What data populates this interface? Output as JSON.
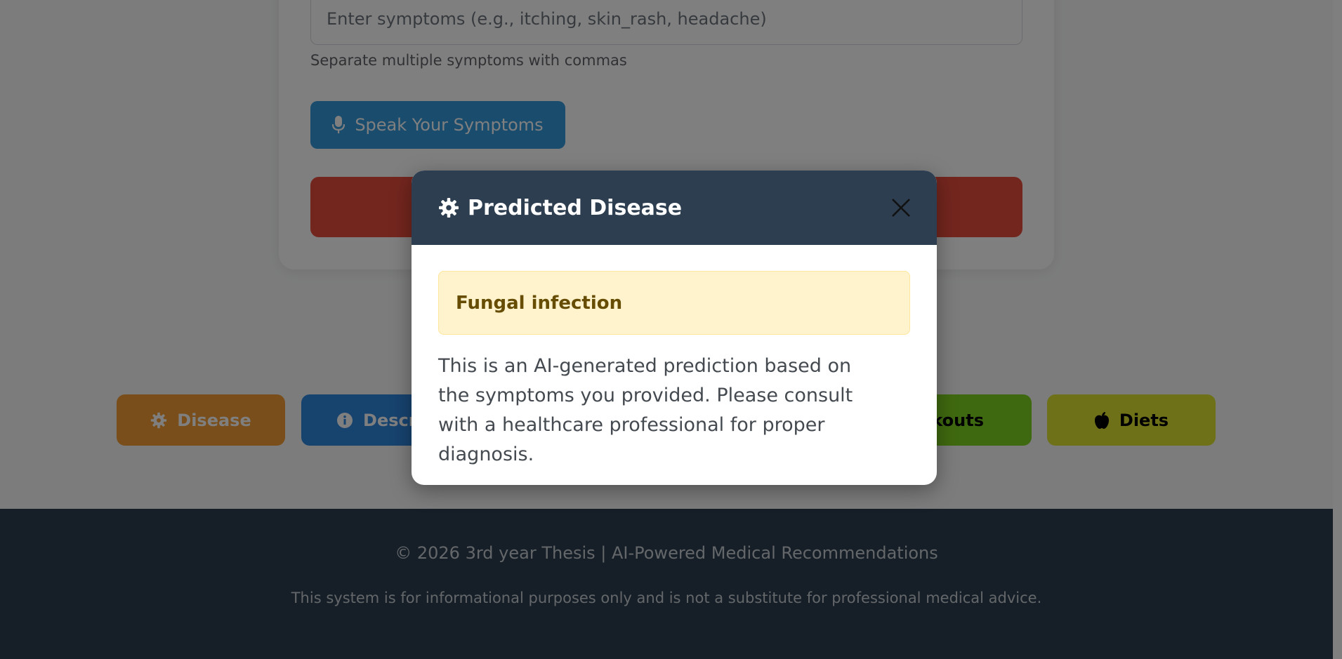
{
  "form": {
    "symptoms_placeholder": "Enter symptoms (e.g., itching, skin_rash, headache)",
    "helper_text": "Separate multiple symptoms with commas",
    "speak_label": "Speak Your Symptoms"
  },
  "tabs": [
    {
      "label": "Disease",
      "icon": "gear-icon",
      "color": "#f39c35"
    },
    {
      "label": "Descrip",
      "icon": "info-icon",
      "color": "#2e86de"
    },
    {
      "label": "orkouts",
      "color": "#7ed321"
    },
    {
      "label": "Diets",
      "icon": "apple-icon",
      "color": "#dde331"
    }
  ],
  "modal": {
    "title": "Predicted Disease",
    "prediction": "Fungal infection",
    "body": "This is an AI-generated prediction based on the symptoms you provided. Please consult with a healthcare professional for proper diagnosis.",
    "header_color": "#2c3e50"
  },
  "footer": {
    "line1": "© 2026 3rd year Thesis | AI-Powered Medical Recommendations",
    "line2": "This system is for informational purposes only and is not a substitute for professional medical advice."
  }
}
